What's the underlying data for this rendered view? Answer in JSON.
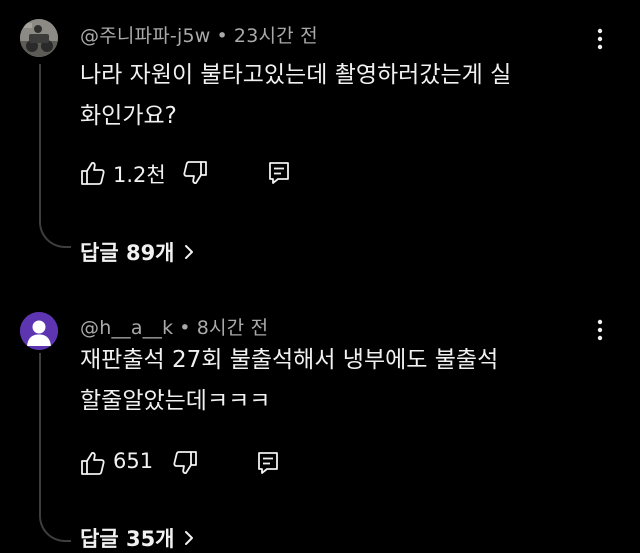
{
  "comments": [
    {
      "author": "@주니파파-j5w",
      "dot": "•",
      "time": "23시간 전",
      "text": "나라 자원이 불타고있는데 촬영하러갔는게 실\n화인가요?",
      "likes": "1.2천",
      "replies_label": "답글 89개",
      "avatar_icon": "user-photo-avatar",
      "avatar_color": "#7a7a74"
    },
    {
      "author": "@h__a__k",
      "dot": "•",
      "time": "8시간 전",
      "text": "재판출석 27회 불출석해서 냉부에도 불출석\n할줄알았는데ㅋㅋㅋ",
      "likes": "651",
      "replies_label": "답글 35개",
      "avatar_icon": "default-user-avatar",
      "avatar_color": "#5e35b1"
    }
  ],
  "colors": {
    "background": "#000000",
    "text": "#f1f1f1",
    "meta": "#aaaaaa",
    "thread_line": "#3d3d3d"
  },
  "icons": {
    "like": "thumbs-up-icon",
    "dislike": "thumbs-down-icon",
    "reply": "comment-icon",
    "more": "kebab-menu-icon",
    "expand": "chevron-right-icon"
  }
}
